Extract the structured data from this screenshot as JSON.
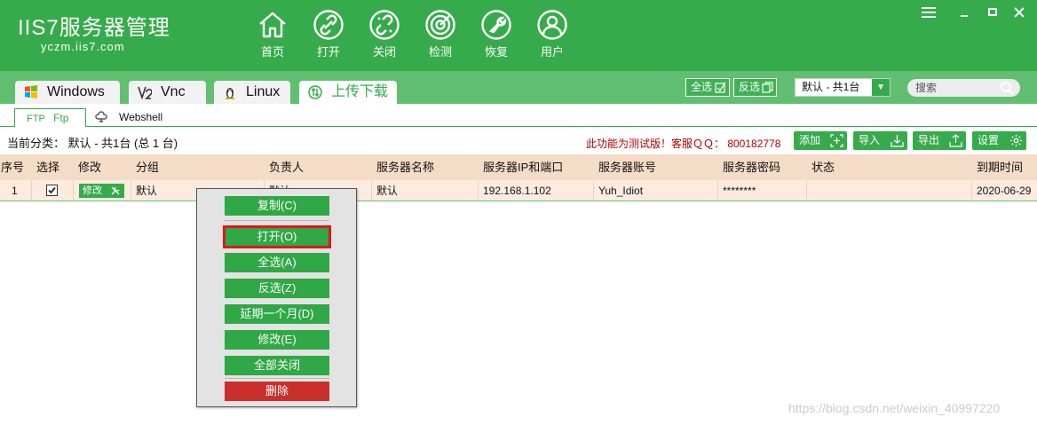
{
  "app": {
    "logo_main": "IIS7服务器管理",
    "logo_sub": "yczm.iis7.com"
  },
  "nav": [
    {
      "label": "首页",
      "icon": "home-icon"
    },
    {
      "label": "打开",
      "icon": "link-icon"
    },
    {
      "label": "关闭",
      "icon": "unlink-icon"
    },
    {
      "label": "检测",
      "icon": "radar-icon"
    },
    {
      "label": "恢复",
      "icon": "wrench-icon"
    },
    {
      "label": "用户",
      "icon": "user-icon"
    }
  ],
  "window_controls": [
    "menu-icon",
    "minimize-icon",
    "maximize-icon",
    "close-icon"
  ],
  "tabs": [
    {
      "label": "Windows",
      "icon": "windows-icon"
    },
    {
      "label": "Vnc",
      "icon": "vnc-icon"
    },
    {
      "label": "Linux",
      "icon": "linux-icon"
    },
    {
      "label": "上传下载",
      "icon": "transfer-icon",
      "active": true
    }
  ],
  "tabbar": {
    "select_all": "全选",
    "invert_select": "反选",
    "group_value": "默认 - 共1台",
    "search_placeholder": "搜索"
  },
  "subtabs": {
    "ftp_prefix": "FTP",
    "ftp": "Ftp",
    "webshell": "Webshell"
  },
  "toolbar": {
    "current_category": "当前分类： 默认 - 共1台 (总 1 台)",
    "notice": "此功能为测试版！客服ＱＱ： 800182778",
    "add": "添加",
    "import": "导入",
    "export": "导出",
    "settings": "设置"
  },
  "table": {
    "columns": [
      "序号",
      "选择",
      "修改",
      "分组",
      "负责人",
      "服务器名称",
      "服务器IP和端口",
      "服务器账号",
      "服务器密码",
      "状态",
      "到期时间"
    ],
    "rows": [
      {
        "index": "1",
        "checked": true,
        "edit_label": "修改",
        "group": "默认",
        "owner": "默认",
        "name": "默认",
        "ip_port": "192.168.1.102",
        "account": "Yuh_Idiot",
        "password": "********",
        "status": "",
        "expiry": "2020-06-29"
      }
    ]
  },
  "context_menu": {
    "items": [
      {
        "label": "复制(C)"
      },
      {
        "label": "打开(O)",
        "selected": true
      },
      {
        "label": "全选(A)"
      },
      {
        "label": "反选(Z)"
      },
      {
        "label": "延期一个月(D)"
      },
      {
        "label": "修改(E)"
      },
      {
        "label": "全部关闭"
      },
      {
        "label": "删除",
        "danger": true
      }
    ]
  },
  "watermark": "https://blog.csdn.net/weixin_40997220",
  "colors": {
    "brand_green": "#36ab4b",
    "tabbar_green": "#60bf70",
    "header_row": "#f5dcc6",
    "data_row": "#fdebe0",
    "notice_red": "#b50000",
    "danger_red": "#c9302c",
    "highlight_red": "#e2161b"
  }
}
